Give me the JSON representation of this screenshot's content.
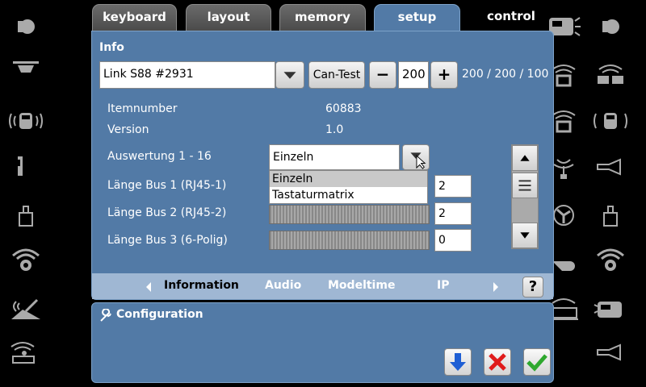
{
  "tabs": {
    "keyboard": "keyboard",
    "layout": "layout",
    "memory": "memory",
    "setup": "setup",
    "control": "control"
  },
  "info": {
    "header": "Info",
    "device_select": "Link S88 #2931",
    "can_test": "Can-Test",
    "minus": "−",
    "plus": "+",
    "number": "200",
    "counts": "200 / 200 / 100"
  },
  "fields": {
    "itemnumber_label": "Itemnumber",
    "itemnumber_value": "60883",
    "version_label": "Version",
    "version_value": "1.0",
    "auswertung_label": "Auswertung 1 - 16",
    "auswertung_value": "Einzeln",
    "bus1_label": "Länge Bus 1 (RJ45-1)",
    "bus1_value": "2",
    "bus2_label": "Länge Bus 2 (RJ45-2)",
    "bus2_value": "2",
    "bus3_label": "Länge Bus 3 (6-Polig)",
    "bus3_value": "0"
  },
  "dropdown_options": [
    "Einzeln",
    "Tastaturmatrix"
  ],
  "bottom_tabs": [
    "Information",
    "Audio",
    "Modeltime",
    "IP"
  ],
  "help": "?",
  "configuration": {
    "title": "Configuration"
  },
  "colors": {
    "panel": "#527aa6",
    "tab_bar": "#9fb7d3",
    "ok": "#2ea82e",
    "cancel": "#e01b1b",
    "download": "#1f5fd4"
  }
}
